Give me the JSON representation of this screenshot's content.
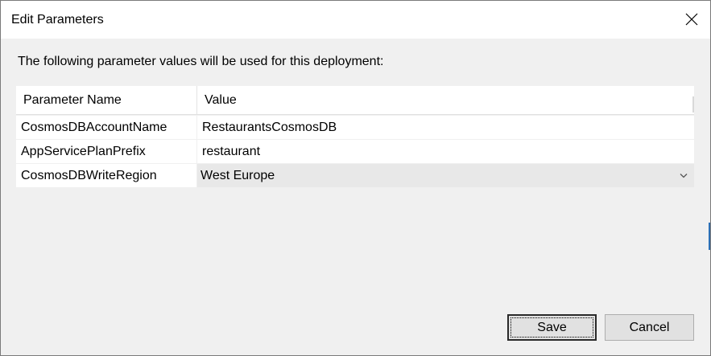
{
  "window": {
    "title": "Edit Parameters"
  },
  "intro_text": "The following parameter values will be used for this deployment:",
  "grid": {
    "columns": [
      "Parameter Name",
      "Value"
    ],
    "rows": [
      {
        "name": "CosmosDBAccountName",
        "value": "RestaurantsCosmosDB",
        "type": "text"
      },
      {
        "name": "AppServicePlanPrefix",
        "value": "restaurant",
        "type": "text"
      },
      {
        "name": "CosmosDBWriteRegion",
        "value": "West Europe",
        "type": "select"
      }
    ]
  },
  "buttons": {
    "save": "Save",
    "cancel": "Cancel"
  },
  "icons": {
    "close": "close-icon",
    "dropdown": "chevron-down-icon"
  }
}
